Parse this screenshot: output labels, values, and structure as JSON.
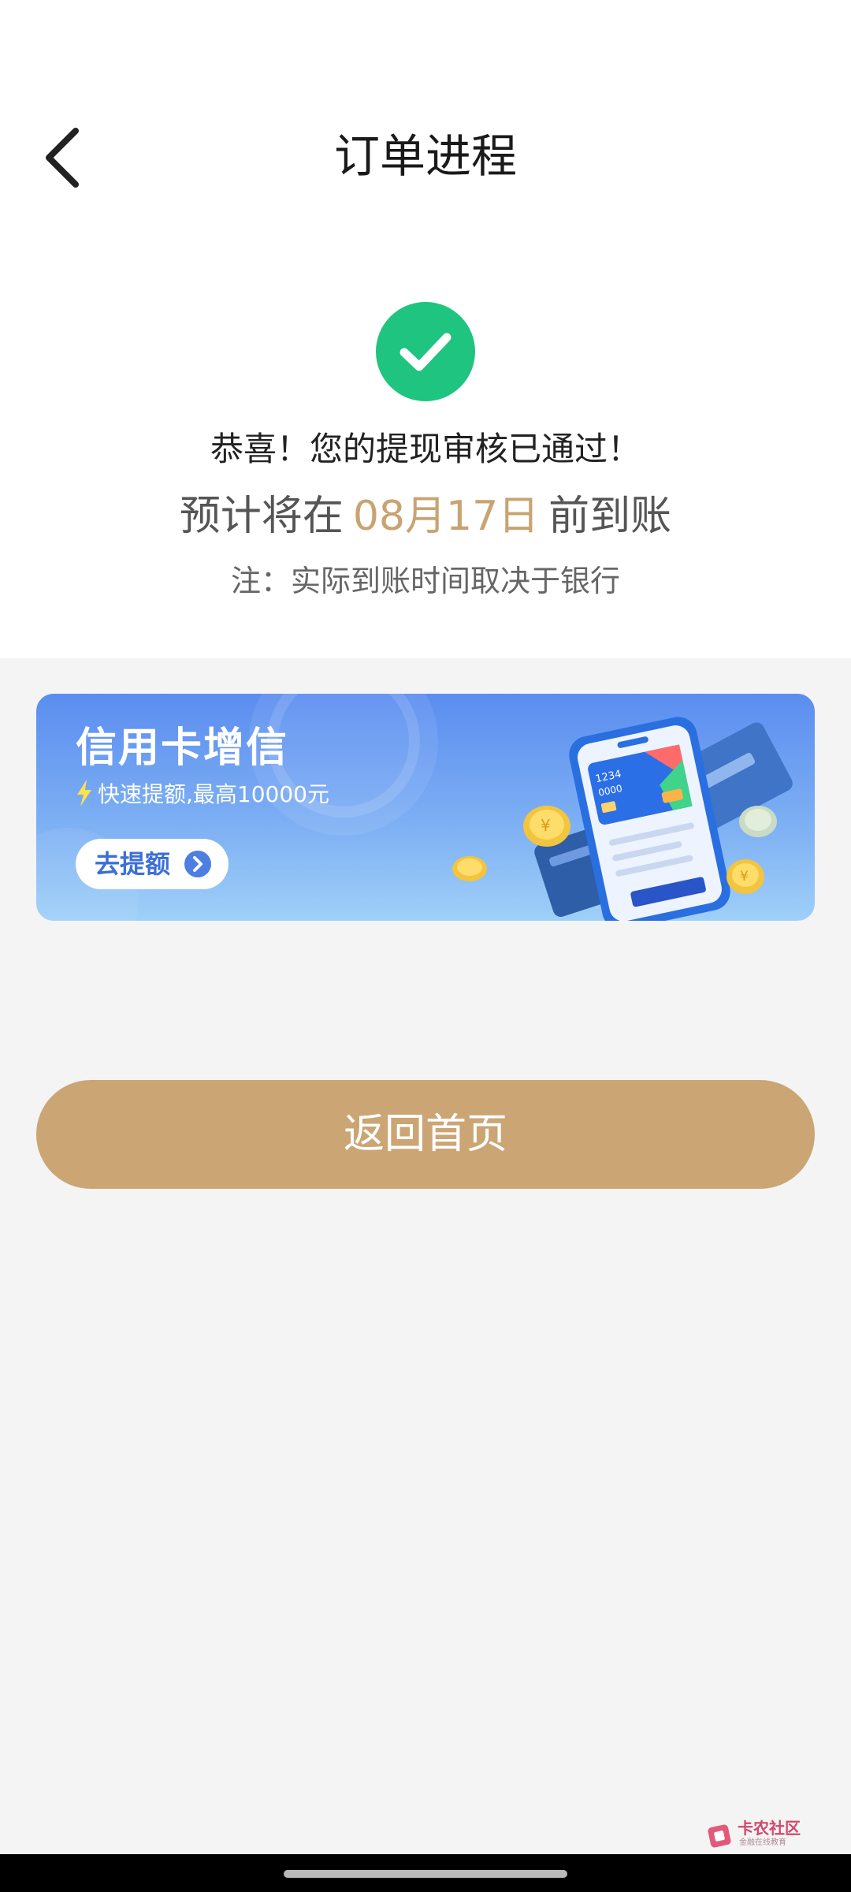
{
  "header": {
    "title": "订单进程",
    "back_icon": "chevron-left-icon"
  },
  "status": {
    "icon": "check-circle-icon",
    "icon_color": "#1ec47f",
    "message": "恭喜！您的提现审核已通过！",
    "arrival_prefix": "预计将在",
    "arrival_date": "08月17日",
    "arrival_suffix": "前到账",
    "date_color": "#c9a372",
    "note": "注：实际到账时间取决于银行"
  },
  "banner": {
    "title": "信用卡增信",
    "subtitle": "快速提额,最高10000元",
    "button_label": "去提额",
    "bolt_icon": "lightning-icon",
    "button_icon": "chevron-right-circle-icon",
    "card_number_1": "1234",
    "card_number_2": "0000"
  },
  "actions": {
    "home_button": "返回首页",
    "home_button_color": "#cba574"
  },
  "watermark": {
    "title": "卡农社区",
    "subtitle": "金融在线教育"
  }
}
